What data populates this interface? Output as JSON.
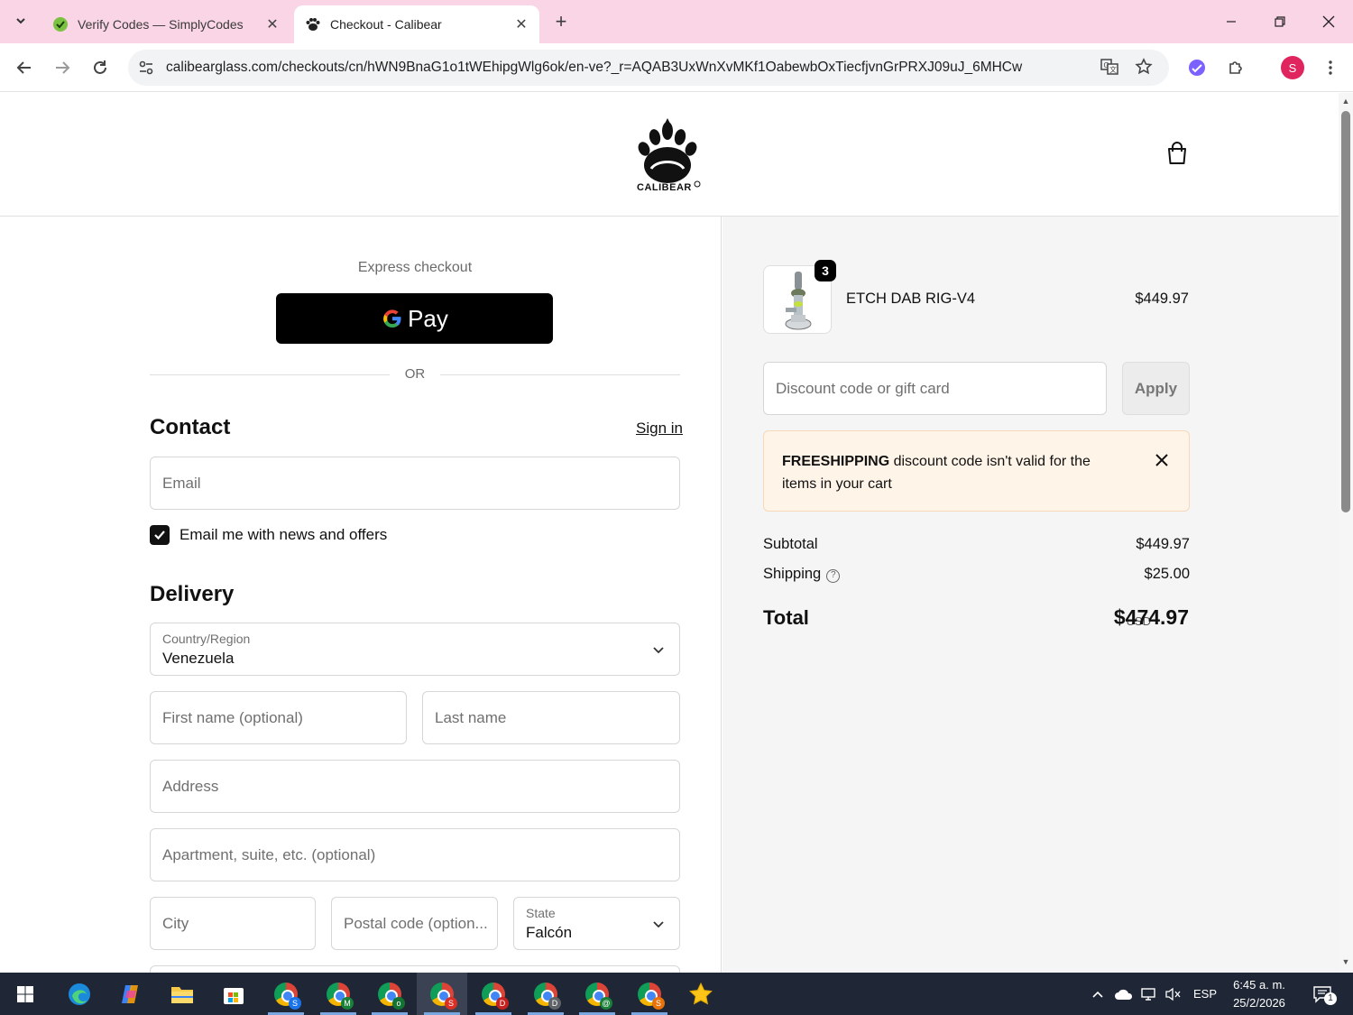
{
  "browser": {
    "tabs": [
      {
        "title": "Verify Codes — SimplyCodes",
        "active": false
      },
      {
        "title": "Checkout - Calibear",
        "active": true
      }
    ],
    "url": "calibearglass.com/checkouts/cn/hWN9BnaG1o1tWEhipgWlg6ok/en-ve?_r=AQAB3UxWnXvMKf1OabewbOxTiecfjvnGrPRXJ09uJ_6MHCw",
    "profile_initial": "S"
  },
  "header": {
    "logo_text": "CALIBEAR"
  },
  "express": {
    "label": "Express checkout",
    "gpay_label": "Pay",
    "or_text": "OR"
  },
  "contact": {
    "title": "Contact",
    "sign_in": "Sign in",
    "email_placeholder": "Email",
    "newsletter_label": "Email me with news and offers",
    "newsletter_checked": true
  },
  "delivery": {
    "title": "Delivery",
    "country_label": "Country/Region",
    "country_value": "Venezuela",
    "first_name_placeholder": "First name (optional)",
    "last_name_placeholder": "Last name",
    "address_placeholder": "Address",
    "apartment_placeholder": "Apartment, suite, etc. (optional)",
    "city_placeholder": "City",
    "postal_placeholder": "Postal code (option...",
    "state_label": "State",
    "state_value": "Falcón"
  },
  "summary": {
    "product": {
      "name": "ETCH DAB RIG-V4",
      "price": "$449.97",
      "quantity": "3"
    },
    "discount_placeholder": "Discount code or gift card",
    "apply_label": "Apply",
    "notice_code": "FREESHIPPING",
    "notice_text": " discount code isn't valid for the items in your cart",
    "subtotal_label": "Subtotal",
    "subtotal_value": "$449.97",
    "shipping_label": "Shipping",
    "shipping_value": "$25.00",
    "total_label": "Total",
    "total_currency": "USD",
    "total_value": "$474.97"
  },
  "taskbar": {
    "language": "ESP",
    "time": "6:45 a. m.",
    "date": "25/2/2026",
    "notifications": "1",
    "chrome_profiles": [
      {
        "letter": "S",
        "color": "#1a73e8"
      },
      {
        "letter": "M",
        "color": "#188038"
      },
      {
        "letter": "o",
        "color": "#137333"
      },
      {
        "letter": "S",
        "color": "#d93025"
      },
      {
        "letter": "D",
        "color": "#c5221f"
      },
      {
        "letter": "D",
        "color": "#5f6368"
      },
      {
        "letter": "@",
        "color": "#188038"
      },
      {
        "letter": "S",
        "color": "#e8710a"
      }
    ]
  },
  "colors": {
    "tabbar_bg": "#f9d5e5",
    "notice_bg": "#fff4e8",
    "summary_bg": "#f5f5f5",
    "button_black": "#000000",
    "taskbar_bg": "#1f2736"
  }
}
